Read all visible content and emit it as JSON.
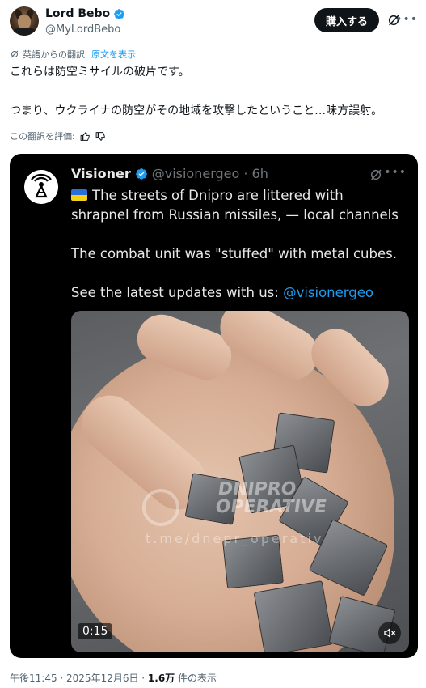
{
  "author": {
    "display_name": "Lord Bebo",
    "handle": "@MyLordBebo"
  },
  "buy_button_label": "購入する",
  "translation": {
    "notice": "英語からの翻訳",
    "show_original": "原文を表示",
    "rate_prompt": "この翻訳を評価:"
  },
  "post": {
    "line1": "これらは防空ミサイルの破片です。",
    "line2": "つまり、ウクライナの防空がその地域を攻撃したということ…味方誤射。"
  },
  "quoted": {
    "display_name": "Visioner",
    "handle_time": "@visionergeo · 6h",
    "line1": "The streets of Dnipro are littered with",
    "line2": "shrapnel from Russian missiles, — local channels",
    "line3": "The combat unit was \"stuffed\" with metal cubes.",
    "line4_prefix": "See the latest updates with us: ",
    "line4_mention": "@visionergeo",
    "video": {
      "duration": "0:15",
      "watermark_line1": "DNIPRO",
      "watermark_line2": "OPERATIVE",
      "watermark_url": "t.me/dnepr_operativ"
    }
  },
  "meta": {
    "time_date": "午後11:45 · 2025年12月6日 · ",
    "views_count": "1.6万",
    "views_label": " 件の表示"
  },
  "colors": {
    "accent": "#1d9bf0",
    "text": "#0f1419",
    "secondary": "#536471"
  }
}
